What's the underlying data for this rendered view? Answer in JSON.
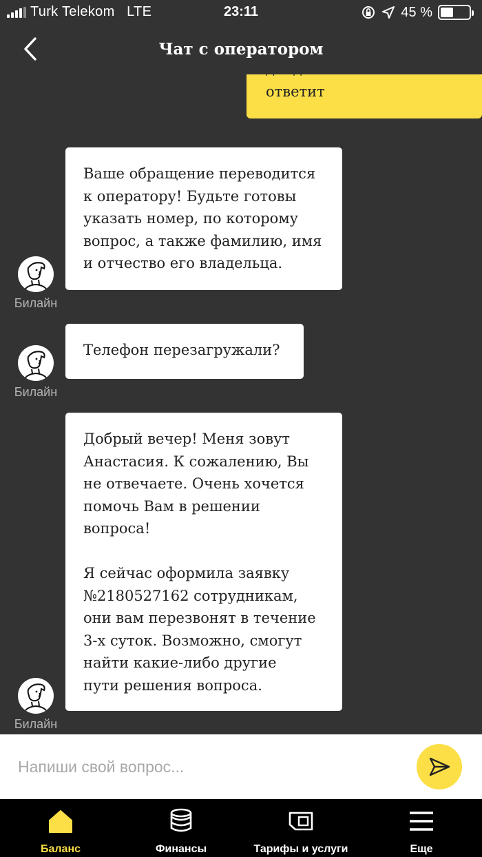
{
  "status_bar": {
    "carrier": "Turk Telekom",
    "network": "LTE",
    "time": "23:11",
    "battery_percent": "45 %",
    "battery_level": 0.45,
    "icons": [
      "signal-icon",
      "rotation-lock-icon",
      "location-icon",
      "battery-icon"
    ]
  },
  "header": {
    "title": "Чат с оператором",
    "back_icon": "chevron-left-icon"
  },
  "chat": {
    "messages": [
      {
        "from": "user",
        "lines": [
          "дойдет и кто мне",
          "ответит"
        ]
      },
      {
        "from": "bot",
        "sender": "Билайн",
        "text": "Ваше обращение переводится\nк оператору! Будьте готовы\nуказать номер, по которому\nвопрос, а также фамилию, имя\nи отчество его владельца."
      },
      {
        "from": "bot",
        "sender": "Билайн",
        "text": "Телефон перезагружали?"
      },
      {
        "from": "bot",
        "sender": "Билайн",
        "text": "Добрый вечер! Меня зовут\nАнастасия. К сожалению, Вы\nне отвечаете. Очень хочется\nпомочь Вам в решении\nвопроса!\n\nЯ сейчас оформила заявку\n№2180527162 сотрудникам,\nони вам перезвонят в течение\n3-х суток. Возможно, смогут\nнайти какие-либо другие\nпути решения вопроса."
      }
    ]
  },
  "input": {
    "placeholder": "Напиши свой вопрос...",
    "value": "",
    "send_icon": "send-arrow-icon"
  },
  "tab_bar": {
    "tabs": [
      {
        "label": "Баланс",
        "icon": "home-icon",
        "active": true
      },
      {
        "label": "Финансы",
        "icon": "coins-icon",
        "active": false
      },
      {
        "label": "Тарифы и услуги",
        "icon": "sim-card-icon",
        "active": false
      },
      {
        "label": "Еще",
        "icon": "menu-icon",
        "active": false
      }
    ]
  },
  "colors": {
    "background": "#333333",
    "accent_yellow": "#fcdf47",
    "bubble_bot": "#ffffff",
    "tab_bar": "#000000",
    "sender_label": "#b4b4b4"
  }
}
